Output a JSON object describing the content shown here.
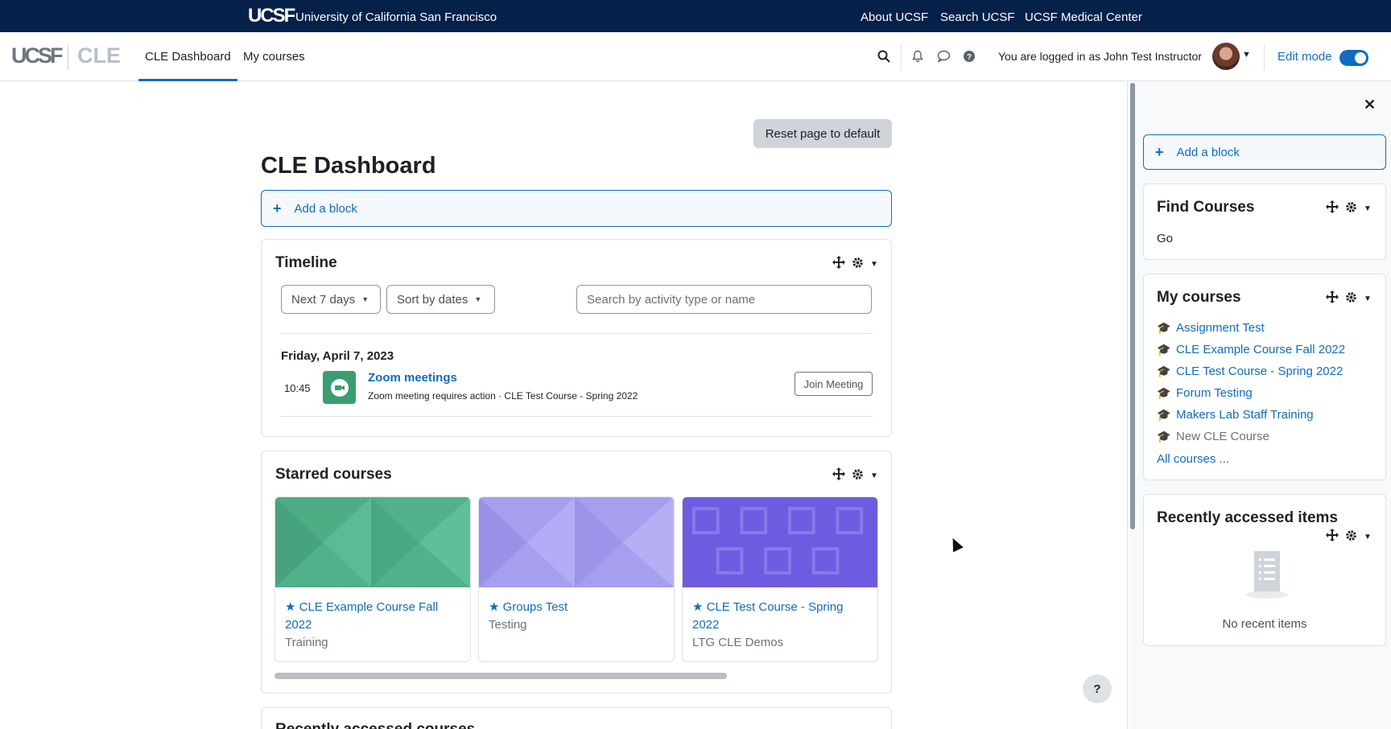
{
  "topbar": {
    "logo": "UCSF",
    "university": "University of California San Francisco",
    "links": [
      "About UCSF",
      "Search UCSF",
      "UCSF Medical Center"
    ]
  },
  "navbar": {
    "brand_ucsf": "UCSF",
    "brand_cle": "CLE",
    "links": [
      "CLE Dashboard",
      "My courses"
    ],
    "user_text": "You are logged in as John Test Instructor",
    "edit_mode": "Edit mode",
    "icons": [
      "search-icon",
      "bell-icon",
      "chat-icon",
      "help-icon"
    ]
  },
  "main": {
    "reset_button": "Reset page to default",
    "title": "CLE Dashboard",
    "add_block": "Add a block"
  },
  "timeline": {
    "title": "Timeline",
    "filter_days": "Next 7 days",
    "sort": "Sort by dates",
    "search_placeholder": "Search by activity type or name",
    "date": "Friday, April 7, 2023",
    "event": {
      "time": "10:45",
      "name": "Zoom meetings",
      "detail": "Zoom meeting requires action · CLE Test Course - Spring 2022",
      "action": "Join Meeting"
    }
  },
  "starred": {
    "title": "Starred courses",
    "courses": [
      {
        "name": "CLE Example Course Fall 2022",
        "category": "Training"
      },
      {
        "name": "Groups Test",
        "category": "Testing"
      },
      {
        "name": "CLE Test Course - Spring 2022",
        "category": "LTG CLE Demos"
      }
    ]
  },
  "recent_courses": {
    "title": "Recently accessed courses"
  },
  "drawer": {
    "add_block": "Add a block",
    "find_courses": {
      "title": "Find Courses",
      "go": "Go"
    },
    "my_courses": {
      "title": "My courses",
      "items": [
        "Assignment Test",
        "CLE Example Course Fall 2022",
        "CLE Test Course - Spring 2022",
        "Forum Testing",
        "Makers Lab Staff Training",
        "New CLE Course"
      ],
      "all": "All courses ..."
    },
    "recent_items": {
      "title": "Recently accessed items",
      "empty": "No recent items"
    }
  },
  "help": "?",
  "colors": {
    "topbar": "#052049",
    "accent": "#0f6cbf"
  }
}
